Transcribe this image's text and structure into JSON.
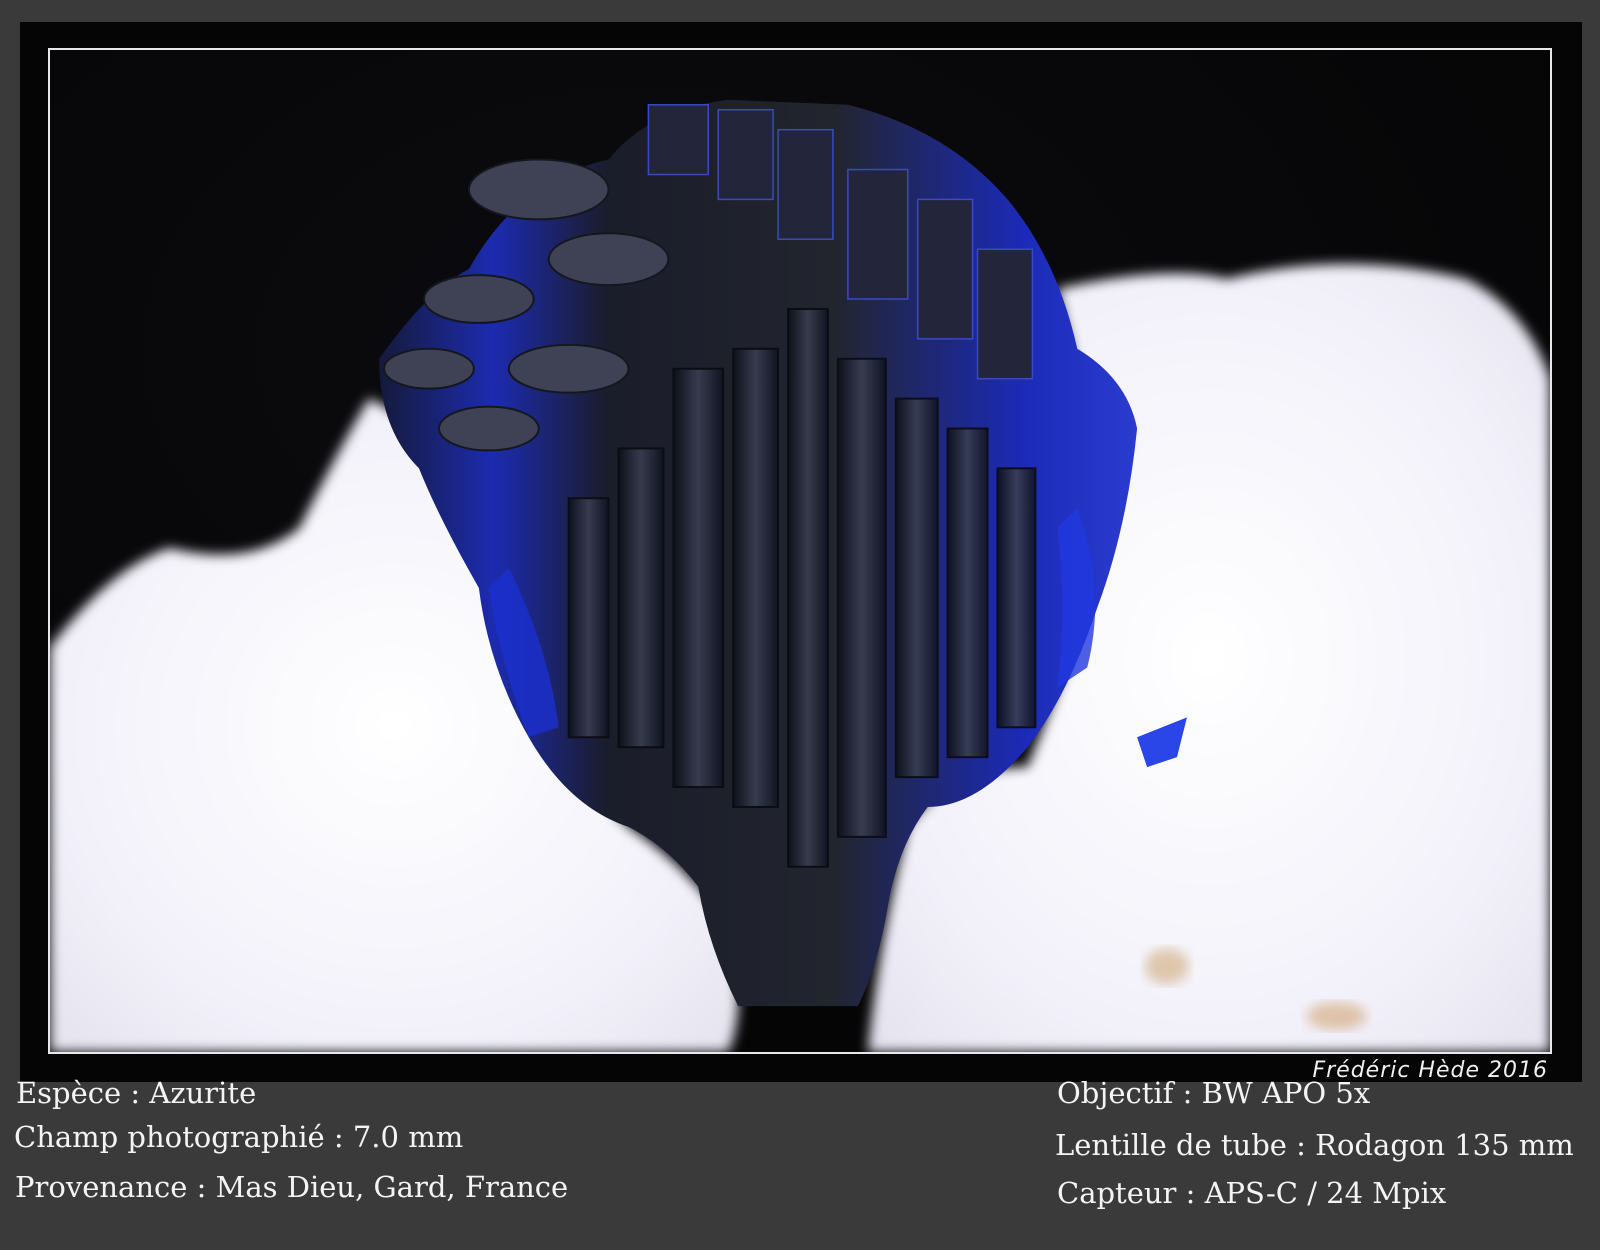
{
  "photo": {
    "subject": "azurite crystal cluster on white matrix",
    "colors": {
      "background": "#050505",
      "crystal": "#1a1f3a",
      "crystal_blue": "#1a2bb0",
      "matrix": "#f4f4fb"
    }
  },
  "signature": "Frédéric Hède 2016",
  "left_info": [
    "Espèce : Azurite",
    "Champ photographié : 7.0 mm",
    "Provenance : Mas Dieu, Gard, France"
  ],
  "right_info": [
    "Objectif : BW APO 5x",
    "Lentille de tube : Rodagon 135 mm",
    "Capteur : APS-C / 24 Mpix"
  ]
}
